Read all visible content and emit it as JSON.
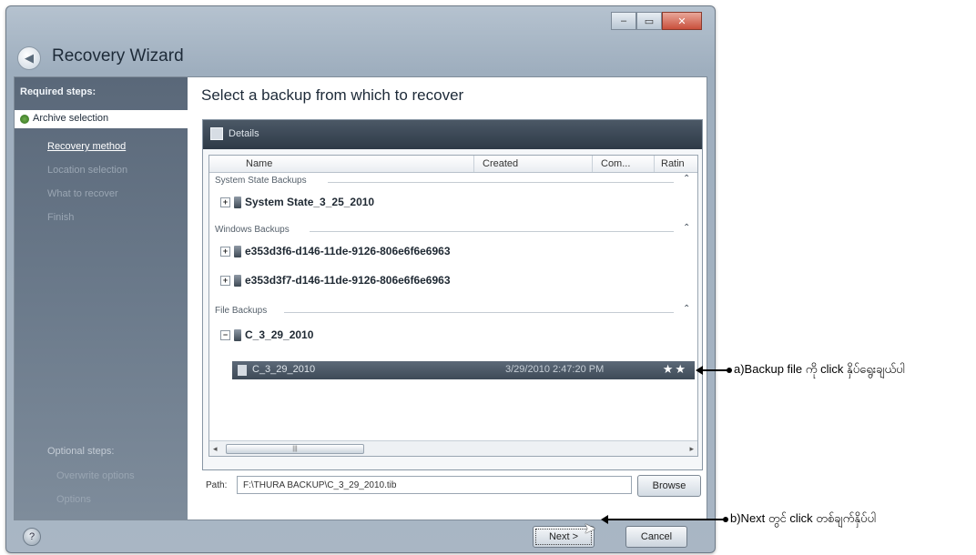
{
  "window": {
    "title": "Recovery Wizard",
    "controls": {
      "minimize": "–",
      "maximize": "▭",
      "close": "✕"
    },
    "back_icon": "back-arrow-icon"
  },
  "sidebar": {
    "required_heading": "Required steps:",
    "selected_item": "Archive selection",
    "items": [
      {
        "label": "Recovery method",
        "state": "active"
      },
      {
        "label": "Location selection",
        "state": "dim"
      },
      {
        "label": "What to recover",
        "state": "dim"
      },
      {
        "label": "Finish",
        "state": "dim"
      }
    ],
    "optional_heading": "Optional steps:",
    "optional_items": [
      {
        "label": "Overwrite options"
      },
      {
        "label": "Options"
      }
    ]
  },
  "main": {
    "title": "Select a backup from which to recover",
    "panel_title": "Details",
    "columns": {
      "name": "Name",
      "created": "Created",
      "comment": "Com...",
      "rating": "Ratin"
    },
    "groups": [
      {
        "label": "System State Backups",
        "items": [
          "System State_3_25_2010"
        ]
      },
      {
        "label": "Windows Backups",
        "items": [
          "e353d3f6-d146-11de-9126-806e6f6e6963",
          "e353d3f7-d146-11de-9126-806e6f6e6963"
        ]
      },
      {
        "label": "File Backups",
        "items": [
          "C_3_29_2010"
        ]
      }
    ],
    "selected_row": {
      "name": "C_3_29_2010",
      "created": "3/29/2010 2:47:20 PM",
      "rating": "★★"
    },
    "path_label": "Path:",
    "path_value": "F:\\THURA BACKUP\\C_3_29_2010.tib",
    "browse_label": "Browse"
  },
  "footer": {
    "next_label": "Next >",
    "cancel_label": "Cancel",
    "help_icon": "help-icon"
  },
  "annotations": {
    "a": "a)Backup file ကို click နှိပ်ရွေးချယ်ပါ",
    "b": "b)Next တွင် click တစ်ချက်နှိပ်ပါ"
  },
  "colors": {
    "sidebar_top": "#5a6879",
    "selected_row": "#4c5967",
    "panel_header": "#3a4653"
  }
}
